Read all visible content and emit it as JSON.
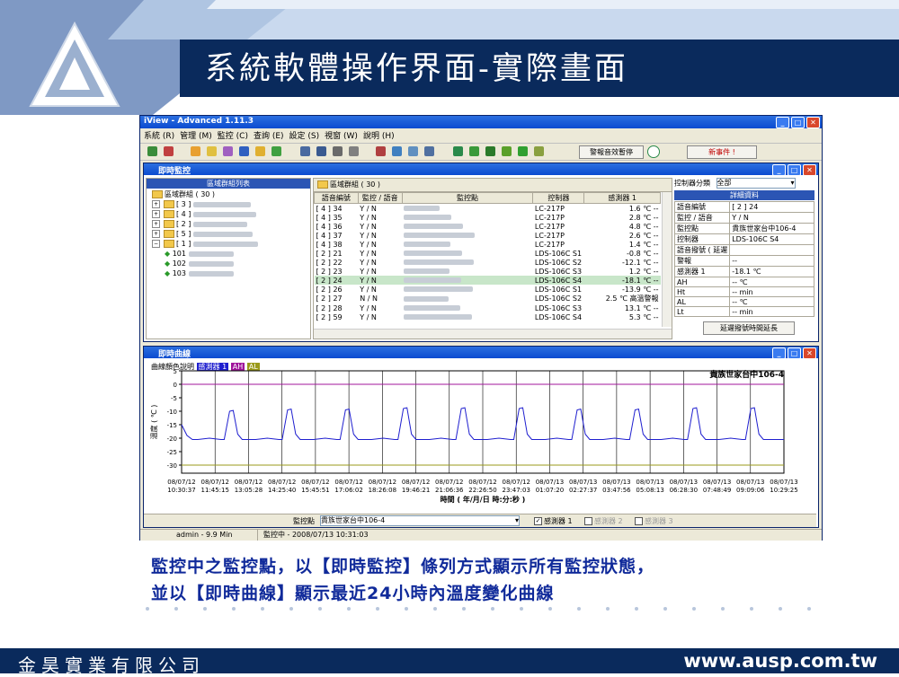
{
  "slide": {
    "title": "系統軟體操作界面-實際畫面",
    "caption_line1": "監控中之監控點，以【即時監控】條列方式顯示所有監控狀態，",
    "caption_line2": "並以【即時曲線】顯示最近24小時內溫度變化曲線",
    "footer_company": "金昊實業有限公司",
    "footer_url": "www.ausp.com.tw"
  },
  "app": {
    "title": "iView - Advanced 1.11.3",
    "menu": [
      "系統 (R)",
      "管理 (M)",
      "監控 (C)",
      "查詢 (E)",
      "設定 (S)",
      "視窗 (W)",
      "說明 (H)"
    ],
    "btn_mute": "警報音效暫停",
    "btn_new_event": "新事件 !",
    "status_user": "admin - 9.9 Min",
    "status_monitor": "監控中 - 2008/07/13 10:31:03"
  },
  "monitor": {
    "title": "即時監控",
    "tree_header": "區域群組列表",
    "tree_root": "區域群組 ( 30 )",
    "tree_groups": [
      "[ 3 ]",
      "[ 4 ]",
      "[ 2 ]",
      "[ 5 ]",
      "[ 1 ]"
    ],
    "tree_points": [
      "101",
      "102",
      "103"
    ],
    "list_header": "區域群組 ( 30 )",
    "columns": [
      "語音編號",
      "監控 / 語音",
      "監控點",
      "控制器",
      "感測器 1"
    ],
    "rows": [
      {
        "id": "[ 4 ] 34",
        "mv": "Y / N",
        "ctrl": "LC-217P",
        "s1": "1.6 ℃ --"
      },
      {
        "id": "[ 4 ] 35",
        "mv": "Y / N",
        "ctrl": "LC-217P",
        "s1": "2.8 ℃ --"
      },
      {
        "id": "[ 4 ] 36",
        "mv": "Y / N",
        "ctrl": "LC-217P",
        "s1": "4.8 ℃ --"
      },
      {
        "id": "[ 4 ] 37",
        "mv": "Y / N",
        "ctrl": "LC-217P",
        "s1": "2.6 ℃ --"
      },
      {
        "id": "[ 4 ] 38",
        "mv": "Y / N",
        "ctrl": "LC-217P",
        "s1": "1.4 ℃ --"
      },
      {
        "id": "[ 2 ] 21",
        "mv": "Y / N",
        "ctrl": "LDS-106C S1",
        "s1": "-0.8 ℃ --"
      },
      {
        "id": "[ 2 ] 22",
        "mv": "Y / N",
        "ctrl": "LDS-106C S2",
        "s1": "-12.1 ℃ --"
      },
      {
        "id": "[ 2 ] 23",
        "mv": "Y / N",
        "ctrl": "LDS-106C S3",
        "s1": "1.2 ℃ --"
      },
      {
        "id": "[ 2 ] 24",
        "mv": "Y / N",
        "ctrl": "LDS-106C S4",
        "s1": "-18.1 ℃ --"
      },
      {
        "id": "[ 2 ] 26",
        "mv": "Y / N",
        "ctrl": "LDS-106C S1",
        "s1": "-13.9 ℃ --"
      },
      {
        "id": "[ 2 ] 27",
        "mv": "N / N",
        "ctrl": "LDS-106C S2",
        "s1": "2.5 ℃ 高溫警報"
      },
      {
        "id": "[ 2 ] 28",
        "mv": "Y / N",
        "ctrl": "LDS-106C S3",
        "s1": "13.1 ℃ --"
      },
      {
        "id": "[ 2 ] 59",
        "mv": "Y / N",
        "ctrl": "LDS-106C S4",
        "s1": "5.3 ℃ --"
      }
    ],
    "selected_row": 8,
    "filter_label": "控制器分類",
    "filter_value": "全部",
    "detail_header": "詳細資料",
    "details": [
      [
        "語音編號",
        "[ 2 ] 24"
      ],
      [
        "監控 / 語音",
        "Y / N"
      ],
      [
        "監控點",
        "貴族世家台中106-4"
      ],
      [
        "控制器",
        "LDS-106C S4"
      ],
      [
        "語音撥號 ( 延遲",
        ""
      ],
      [
        "警報",
        "--"
      ],
      [
        "感測器 1",
        "-18.1 ℃"
      ],
      [
        "AH",
        "-- ℃"
      ],
      [
        "Ht",
        "-- min"
      ],
      [
        "AL",
        "-- ℃"
      ],
      [
        "Lt",
        "-- min"
      ]
    ],
    "delay_button": "延遲撥號時間延長"
  },
  "curve": {
    "title": "即時曲線",
    "legend_label": "曲線顏色說明",
    "legend_items": [
      {
        "label": "感測器 1",
        "color": "#1f1fcf"
      },
      {
        "label": "AH",
        "color": "#a0159b"
      },
      {
        "label": "AL",
        "color": "#9a9a1a"
      }
    ],
    "point_label": "監控點",
    "point_value": "貴族世家台中106-4",
    "checkboxes": [
      {
        "label": "感測器 1",
        "checked": true
      },
      {
        "label": "感測器 2",
        "checked": false
      },
      {
        "label": "感測器 3",
        "checked": false
      }
    ]
  },
  "chart_data": {
    "type": "line",
    "title": "貴族世家台中106-4",
    "xlabel": "時間 ( 年/月/日 時:分:秒 )",
    "ylabel": "溫度 ( ℃ )",
    "ylim": [
      -33,
      5
    ],
    "yticks": [
      5,
      0,
      -5,
      -10,
      -15,
      -20,
      -25,
      -30
    ],
    "grid": true,
    "xticks": [
      [
        "08/07/12",
        "10:30:37"
      ],
      [
        "08/07/12",
        "11:45:15"
      ],
      [
        "08/07/12",
        "13:05:28"
      ],
      [
        "08/07/12",
        "14:25:40"
      ],
      [
        "08/07/12",
        "15:45:51"
      ],
      [
        "08/07/12",
        "17:06:02"
      ],
      [
        "08/07/12",
        "18:26:08"
      ],
      [
        "08/07/12",
        "19:46:21"
      ],
      [
        "08/07/12",
        "21:06:36"
      ],
      [
        "08/07/12",
        "22:26:50"
      ],
      [
        "08/07/12",
        "23:47:03"
      ],
      [
        "08/07/13",
        "01:07:20"
      ],
      [
        "08/07/13",
        "02:27:37"
      ],
      [
        "08/07/13",
        "03:47:56"
      ],
      [
        "08/07/13",
        "05:08:13"
      ],
      [
        "08/07/13",
        "06:28:30"
      ],
      [
        "08/07/13",
        "07:48:49"
      ],
      [
        "08/07/13",
        "09:09:06"
      ],
      [
        "08/07/13",
        "10:29:25"
      ]
    ],
    "series": [
      {
        "name": "感測器 1",
        "color": "#1f1fcf",
        "cycle_peaks": [
          -10,
          -9.5,
          -9.5,
          -9,
          -9,
          -9,
          -9.5,
          -9.5,
          -9,
          -9
        ],
        "baseline": -20.5,
        "end": -20.5
      },
      {
        "name": "AH",
        "color": "#a0159b",
        "value": 0
      },
      {
        "name": "AL",
        "color": "#9a9a1a",
        "value": -30
      }
    ]
  }
}
